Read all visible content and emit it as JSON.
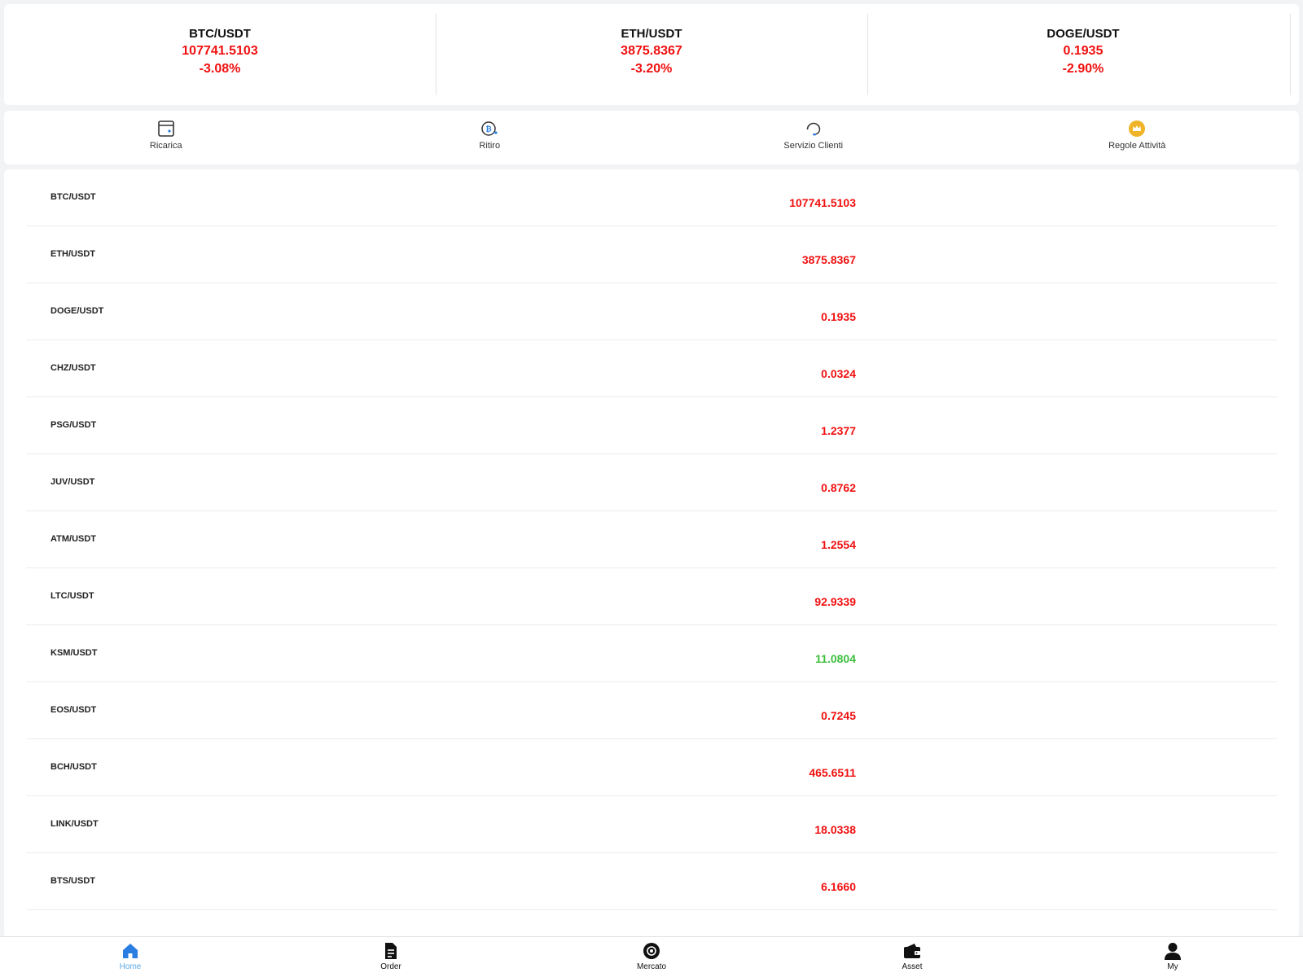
{
  "tickers": [
    {
      "pair": "BTC/USDT",
      "price": "107741.5103",
      "change": "-3.08%"
    },
    {
      "pair": "ETH/USDT",
      "price": "3875.8367",
      "change": "-3.20%"
    },
    {
      "pair": "DOGE/USDT",
      "price": "0.1935",
      "change": "-2.90%"
    }
  ],
  "quick_actions": [
    {
      "label": "Ricarica",
      "icon": "wallet-deposit-icon"
    },
    {
      "label": "Ritiro",
      "icon": "bitcoin-withdraw-icon"
    },
    {
      "label": "Servizio Clienti",
      "icon": "headset-icon"
    },
    {
      "label": "Regole Attività",
      "icon": "crown-icon"
    }
  ],
  "market": [
    {
      "pair": "BTC/USDT",
      "price": "107741.5103",
      "trend": "down"
    },
    {
      "pair": "ETH/USDT",
      "price": "3875.8367",
      "trend": "down"
    },
    {
      "pair": "DOGE/USDT",
      "price": "0.1935",
      "trend": "down"
    },
    {
      "pair": "CHZ/USDT",
      "price": "0.0324",
      "trend": "down"
    },
    {
      "pair": "PSG/USDT",
      "price": "1.2377",
      "trend": "down"
    },
    {
      "pair": "JUV/USDT",
      "price": "0.8762",
      "trend": "down"
    },
    {
      "pair": "ATM/USDT",
      "price": "1.2554",
      "trend": "down"
    },
    {
      "pair": "LTC/USDT",
      "price": "92.9339",
      "trend": "down"
    },
    {
      "pair": "KSM/USDT",
      "price": "11.0804",
      "trend": "up"
    },
    {
      "pair": "EOS/USDT",
      "price": "0.7245",
      "trend": "down"
    },
    {
      "pair": "BCH/USDT",
      "price": "465.6511",
      "trend": "down"
    },
    {
      "pair": "LINK/USDT",
      "price": "18.0338",
      "trend": "down"
    },
    {
      "pair": "BTS/USDT",
      "price": "6.1660",
      "trend": "down"
    }
  ],
  "nav": [
    {
      "label": "Home",
      "icon": "home-icon",
      "active": true
    },
    {
      "label": "Order",
      "icon": "document-icon",
      "active": false
    },
    {
      "label": "Mercato",
      "icon": "market-icon",
      "active": false
    },
    {
      "label": "Asset",
      "icon": "wallet-icon",
      "active": false
    },
    {
      "label": "My",
      "icon": "user-icon",
      "active": false
    }
  ],
  "colors": {
    "down": "#f01010",
    "up": "#3cbf3c",
    "nav_active": "#5aa8e6",
    "accent_blue": "#2a7de1",
    "crown": "#f0b429"
  }
}
